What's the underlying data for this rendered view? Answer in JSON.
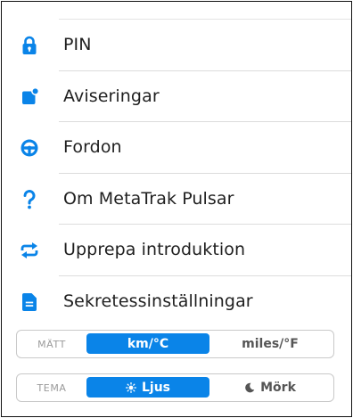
{
  "colors": {
    "accent": "#0a84e8",
    "text": "#1f1f1f",
    "divider": "#dcdcdc",
    "muted": "#9a9a9a"
  },
  "menu": {
    "items": [
      {
        "label": "PIN",
        "icon": "lock-icon"
      },
      {
        "label": "Aviseringar",
        "icon": "notification-icon"
      },
      {
        "label": "Fordon",
        "icon": "steering-wheel-icon"
      },
      {
        "label": "Om MetaTrak Pulsar",
        "icon": "question-mark-icon"
      },
      {
        "label": "Upprepa introduktion",
        "icon": "repeat-icon"
      },
      {
        "label": "Sekretessinställningar",
        "icon": "document-icon"
      }
    ]
  },
  "units": {
    "title": "MÄTT",
    "options": [
      "km/°C",
      "miles/°F"
    ],
    "selected": "km/°C"
  },
  "theme": {
    "title": "TEMA",
    "options": [
      "Ljus",
      "Mörk"
    ],
    "option_icons": [
      "sun-icon",
      "moon-icon"
    ],
    "selected": "Ljus"
  }
}
